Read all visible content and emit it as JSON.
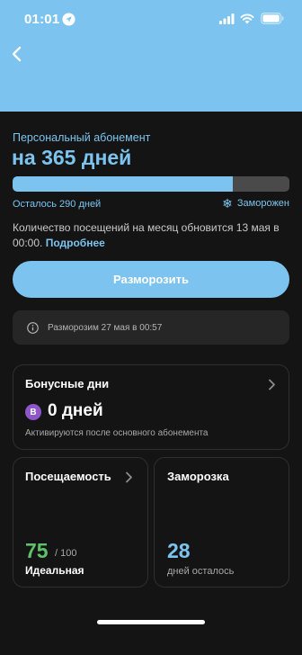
{
  "status_bar": {
    "time": "01:01"
  },
  "header": {
    "back_icon": "chevron-left-icon",
    "background": "#7cc4ef"
  },
  "subscription": {
    "subtitle": "Персональный абонемент",
    "title": "на 365 дней",
    "progress": {
      "used_fraction": 0.795
    },
    "remaining": "Осталось 290 дней",
    "frozen_label": "Заморожен",
    "frozen_icon": "snowflake-icon",
    "info_text": "Количество посещений на месяц обновится 13 мая в 00:00. ",
    "info_link": "Подробнее",
    "accent": "#7cc4ef"
  },
  "unfreeze_button": {
    "label": "Разморозить"
  },
  "notice": {
    "text": "Разморозим 27 мая в 00:57",
    "icon": "info-icon"
  },
  "bonus_card": {
    "title": "Бонусные дни",
    "badge": "B",
    "value": "0 дней",
    "note": "Активируются после основного абонемента"
  },
  "attendance_card": {
    "title": "Посещаемость",
    "value": "75",
    "max": " / 100",
    "label": "Идеальная",
    "value_color": "#5ec26a"
  },
  "freeze_card": {
    "title": "Заморозка",
    "value": "28",
    "label": "дней осталось"
  }
}
